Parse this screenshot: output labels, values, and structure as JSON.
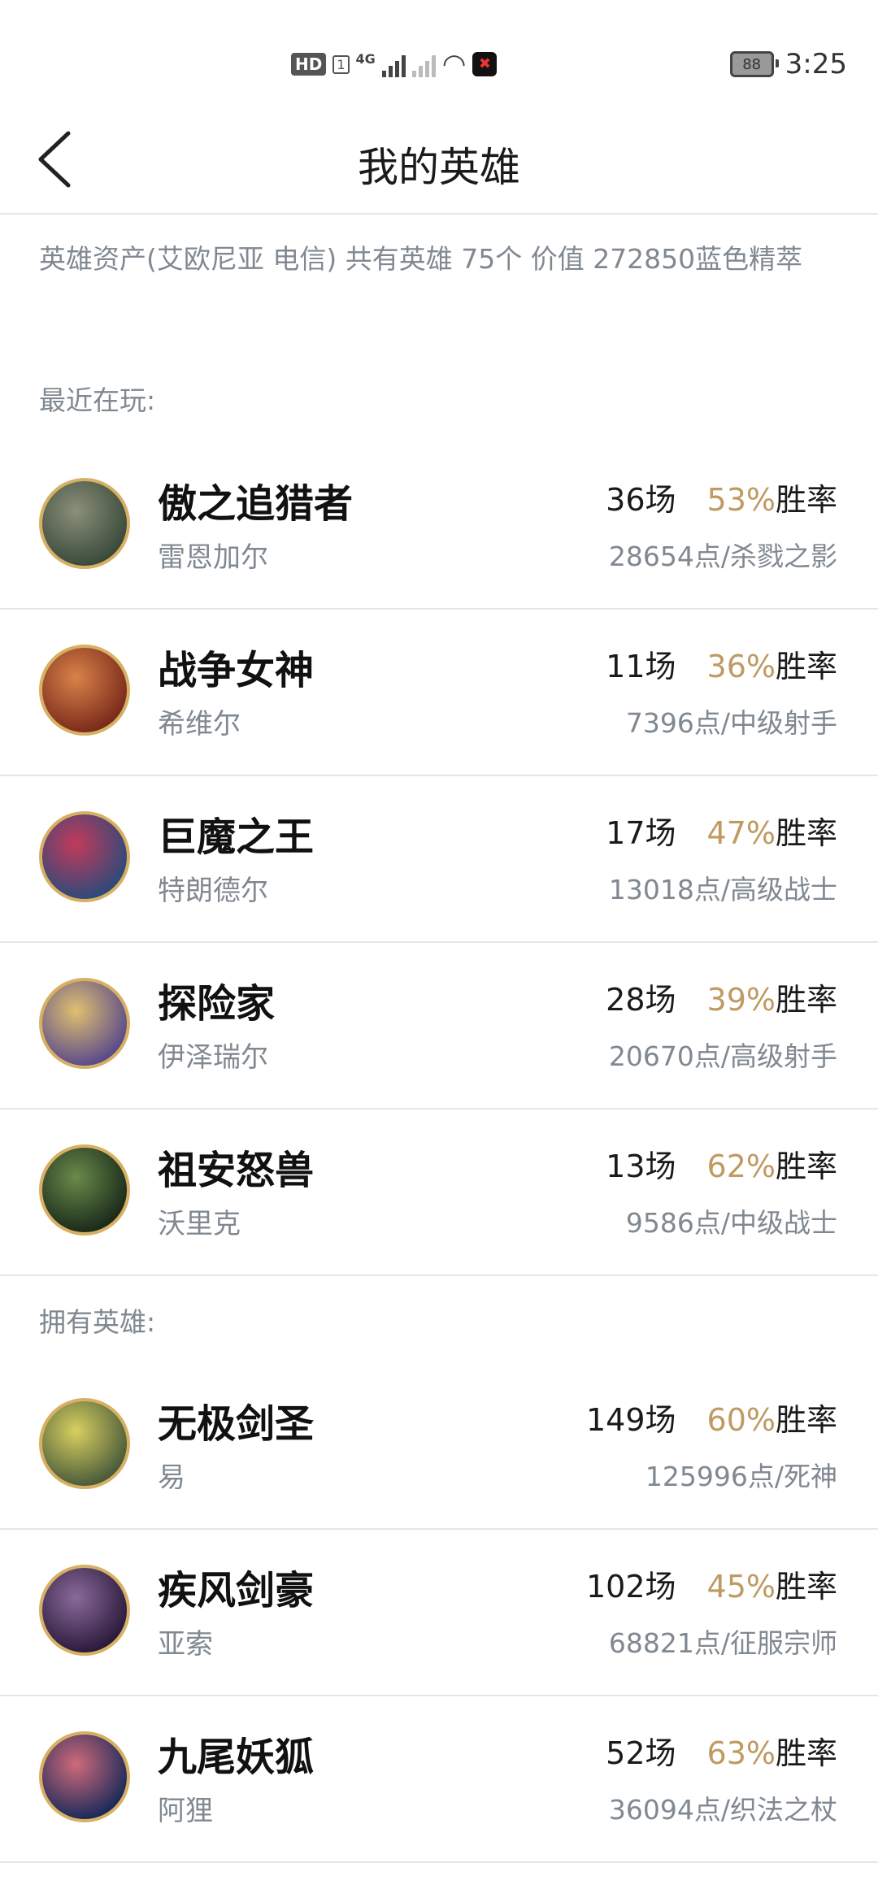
{
  "status_bar": {
    "hd": "HD",
    "sim": "1",
    "net": "4G",
    "battery": "88",
    "time": "3:25"
  },
  "header": {
    "title": "我的英雄",
    "back_icon": "chevron-left-icon"
  },
  "summary": "英雄资产(艾欧尼亚 电信)  共有英雄 75个  价值 272850蓝色精萃",
  "recent_label": "最近在玩:",
  "owned_label": "拥有英雄:",
  "rate_suffix": "胜率",
  "recent_heroes": [
    {
      "title": "傲之追猎者",
      "name": "雷恩加尔",
      "games": "36场",
      "rate": "53%",
      "points": "28654点/杀戮之影",
      "colors": [
        "#3a4a3a",
        "#8a8f7a"
      ]
    },
    {
      "title": "战争女神",
      "name": "希维尔",
      "games": "11场",
      "rate": "36%",
      "points": "7396点/中级射手",
      "colors": [
        "#7a2a1a",
        "#d9824a"
      ]
    },
    {
      "title": "巨魔之王",
      "name": "特朗德尔",
      "games": "17场",
      "rate": "47%",
      "points": "13018点/高级战士",
      "colors": [
        "#2d4a7a",
        "#c23a5a"
      ]
    },
    {
      "title": "探险家",
      "name": "伊泽瑞尔",
      "games": "28场",
      "rate": "39%",
      "points": "20670点/高级射手",
      "colors": [
        "#5a4a8a",
        "#e0c070"
      ]
    },
    {
      "title": "祖安怒兽",
      "name": "沃里克",
      "games": "13场",
      "rate": "62%",
      "points": "9586点/中级战士",
      "colors": [
        "#1a2a1a",
        "#6a8a4a"
      ]
    }
  ],
  "owned_heroes": [
    {
      "title": "无极剑圣",
      "name": "易",
      "games": "149场",
      "rate": "60%",
      "points": "125996点/死神",
      "colors": [
        "#4a5a3a",
        "#d8d060"
      ]
    },
    {
      "title": "疾风剑豪",
      "name": "亚索",
      "games": "102场",
      "rate": "45%",
      "points": "68821点/征服宗师",
      "colors": [
        "#2a1a3a",
        "#8a6a9a"
      ]
    },
    {
      "title": "九尾妖狐",
      "name": "阿狸",
      "games": "52场",
      "rate": "63%",
      "points": "36094点/织法之杖",
      "colors": [
        "#1a2a5a",
        "#d06a7a"
      ]
    }
  ]
}
